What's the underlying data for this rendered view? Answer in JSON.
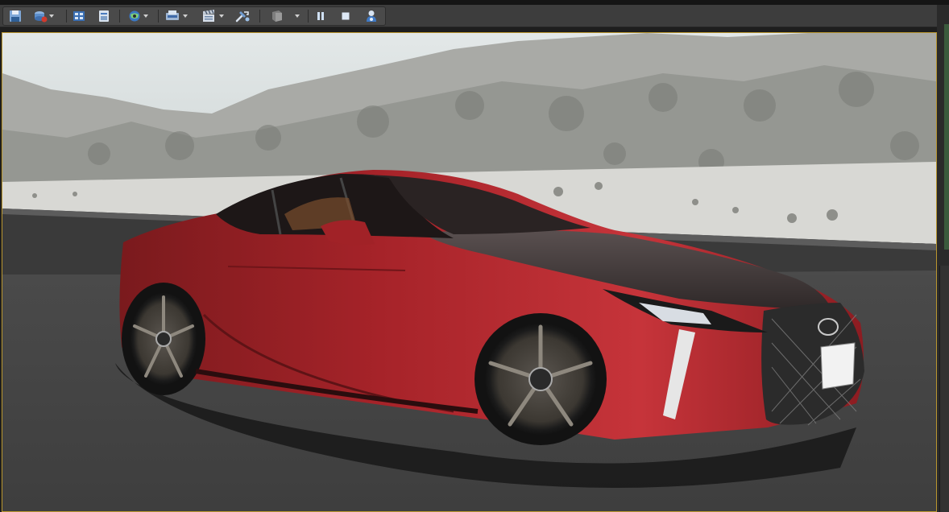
{
  "toolbar": {
    "buttons": [
      {
        "id": "save",
        "icon": "floppy-disk-icon"
      },
      {
        "id": "source-control",
        "icon": "source-control-icon",
        "dropdown": true
      },
      {
        "id": "content",
        "icon": "content-browser-icon"
      },
      {
        "id": "marketplace",
        "icon": "marketplace-icon"
      },
      {
        "id": "settings",
        "icon": "world-settings-icon",
        "dropdown": true
      },
      {
        "id": "blueprints",
        "icon": "blueprints-icon",
        "dropdown": true
      },
      {
        "id": "cinematics",
        "icon": "clapperboard-icon",
        "dropdown": true
      },
      {
        "id": "build",
        "icon": "build-icon"
      },
      {
        "id": "play",
        "icon": "play-icon",
        "dropdown": true
      },
      {
        "id": "pause",
        "icon": "pause-icon"
      },
      {
        "id": "stop",
        "icon": "stop-icon"
      },
      {
        "id": "eject",
        "icon": "possess-pawn-icon"
      }
    ]
  },
  "colors": {
    "toolbar_bg": "#3d3d3d",
    "viewport_border": "#b9962f",
    "car_red": "#b32a30",
    "sky": "#d9dfe0",
    "road": "#4b4b4b"
  },
  "viewport": {
    "scene_icon": "car-render-viewport"
  }
}
